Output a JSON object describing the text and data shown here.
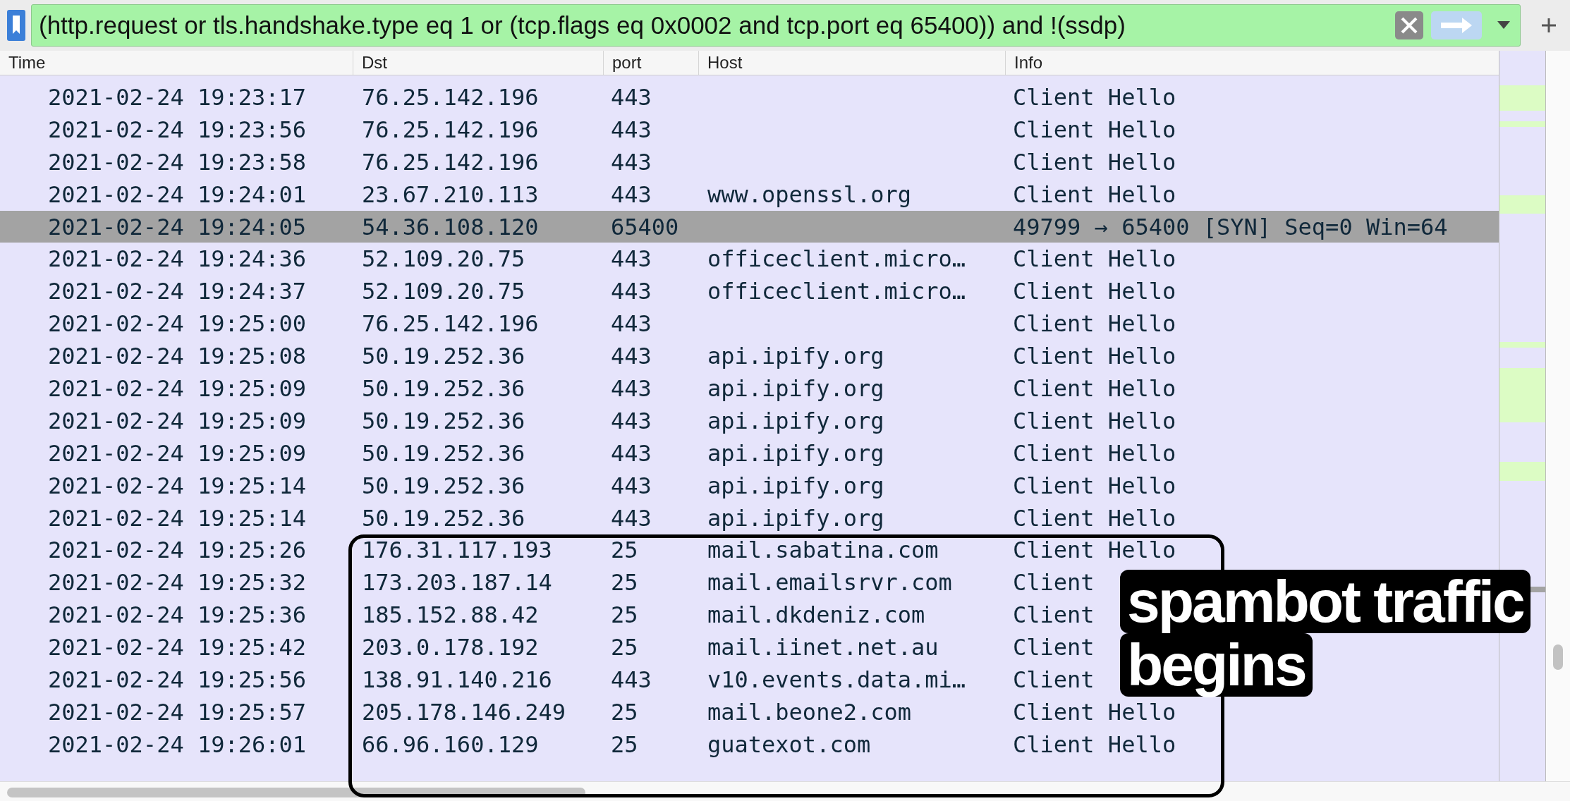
{
  "filter": {
    "text": "(http.request or tls.handshake.type eq 1 or (tcp.flags eq 0x0002 and tcp.port eq 65400)) and !(ssdp)"
  },
  "columns": [
    "Time",
    "Dst",
    "port",
    "Host",
    "Info"
  ],
  "rows": [
    {
      "time": "2021-02-24 19:23:17",
      "dst": "76.25.142.196",
      "port": "443",
      "host": "",
      "info": "Client Hello",
      "selected": false
    },
    {
      "time": "2021-02-24 19:23:56",
      "dst": "76.25.142.196",
      "port": "443",
      "host": "",
      "info": "Client Hello",
      "selected": false
    },
    {
      "time": "2021-02-24 19:23:58",
      "dst": "76.25.142.196",
      "port": "443",
      "host": "",
      "info": "Client Hello",
      "selected": false
    },
    {
      "time": "2021-02-24 19:24:01",
      "dst": "23.67.210.113",
      "port": "443",
      "host": "www.openssl.org",
      "info": "Client Hello",
      "selected": false
    },
    {
      "time": "2021-02-24 19:24:05",
      "dst": "54.36.108.120",
      "port": "65400",
      "host": "",
      "info": "49799 → 65400 [SYN] Seq=0 Win=64",
      "selected": true
    },
    {
      "time": "2021-02-24 19:24:36",
      "dst": "52.109.20.75",
      "port": "443",
      "host": "officeclient.micro…",
      "info": "Client Hello",
      "selected": false
    },
    {
      "time": "2021-02-24 19:24:37",
      "dst": "52.109.20.75",
      "port": "443",
      "host": "officeclient.micro…",
      "info": "Client Hello",
      "selected": false
    },
    {
      "time": "2021-02-24 19:25:00",
      "dst": "76.25.142.196",
      "port": "443",
      "host": "",
      "info": "Client Hello",
      "selected": false
    },
    {
      "time": "2021-02-24 19:25:08",
      "dst": "50.19.252.36",
      "port": "443",
      "host": "api.ipify.org",
      "info": "Client Hello",
      "selected": false
    },
    {
      "time": "2021-02-24 19:25:09",
      "dst": "50.19.252.36",
      "port": "443",
      "host": "api.ipify.org",
      "info": "Client Hello",
      "selected": false
    },
    {
      "time": "2021-02-24 19:25:09",
      "dst": "50.19.252.36",
      "port": "443",
      "host": "api.ipify.org",
      "info": "Client Hello",
      "selected": false
    },
    {
      "time": "2021-02-24 19:25:09",
      "dst": "50.19.252.36",
      "port": "443",
      "host": "api.ipify.org",
      "info": "Client Hello",
      "selected": false
    },
    {
      "time": "2021-02-24 19:25:14",
      "dst": "50.19.252.36",
      "port": "443",
      "host": "api.ipify.org",
      "info": "Client Hello",
      "selected": false
    },
    {
      "time": "2021-02-24 19:25:14",
      "dst": "50.19.252.36",
      "port": "443",
      "host": "api.ipify.org",
      "info": "Client Hello",
      "selected": false
    },
    {
      "time": "2021-02-24 19:25:26",
      "dst": "176.31.117.193",
      "port": "25",
      "host": "mail.sabatina.com",
      "info": "Client Hello",
      "selected": false
    },
    {
      "time": "2021-02-24 19:25:32",
      "dst": "173.203.187.14",
      "port": "25",
      "host": "mail.emailsrvr.com",
      "info": "Client",
      "selected": false
    },
    {
      "time": "2021-02-24 19:25:36",
      "dst": "185.152.88.42",
      "port": "25",
      "host": "mail.dkdeniz.com",
      "info": "Client",
      "selected": false
    },
    {
      "time": "2021-02-24 19:25:42",
      "dst": "203.0.178.192",
      "port": "25",
      "host": "mail.iinet.net.au",
      "info": "Client",
      "selected": false
    },
    {
      "time": "2021-02-24 19:25:56",
      "dst": "138.91.140.216",
      "port": "443",
      "host": "v10.events.data.mi…",
      "info": "Client",
      "selected": false
    },
    {
      "time": "2021-02-24 19:25:57",
      "dst": "205.178.146.249",
      "port": "25",
      "host": "mail.beone2.com",
      "info": "Client Hello",
      "selected": false
    },
    {
      "time": "2021-02-24 19:26:01",
      "dst": "66.96.160.129",
      "port": "25",
      "host": "guatexot.com",
      "info": "Client Hello",
      "selected": false
    }
  ],
  "annotation": {
    "lines": [
      "spambot traffic",
      "begins"
    ]
  }
}
